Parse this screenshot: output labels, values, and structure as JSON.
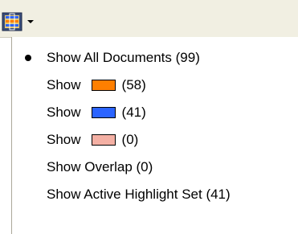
{
  "toolbar": {
    "button_icon": "highlight-set-icon",
    "arrow_icon": "dropdown-arrow-icon"
  },
  "menu": {
    "items": [
      {
        "label": "Show All Documents (99)",
        "selected": true
      },
      {
        "label": "Show",
        "count": "(58)",
        "swatch_color": "#ff7f00"
      },
      {
        "label": "Show",
        "count": "(41)",
        "swatch_color": "#2b64ff"
      },
      {
        "label": "Show",
        "count": "(0)",
        "swatch_color": "#f4b0a4"
      },
      {
        "label": "Show Overlap (0)"
      },
      {
        "label": "Show Active Highlight Set (41)"
      }
    ]
  }
}
